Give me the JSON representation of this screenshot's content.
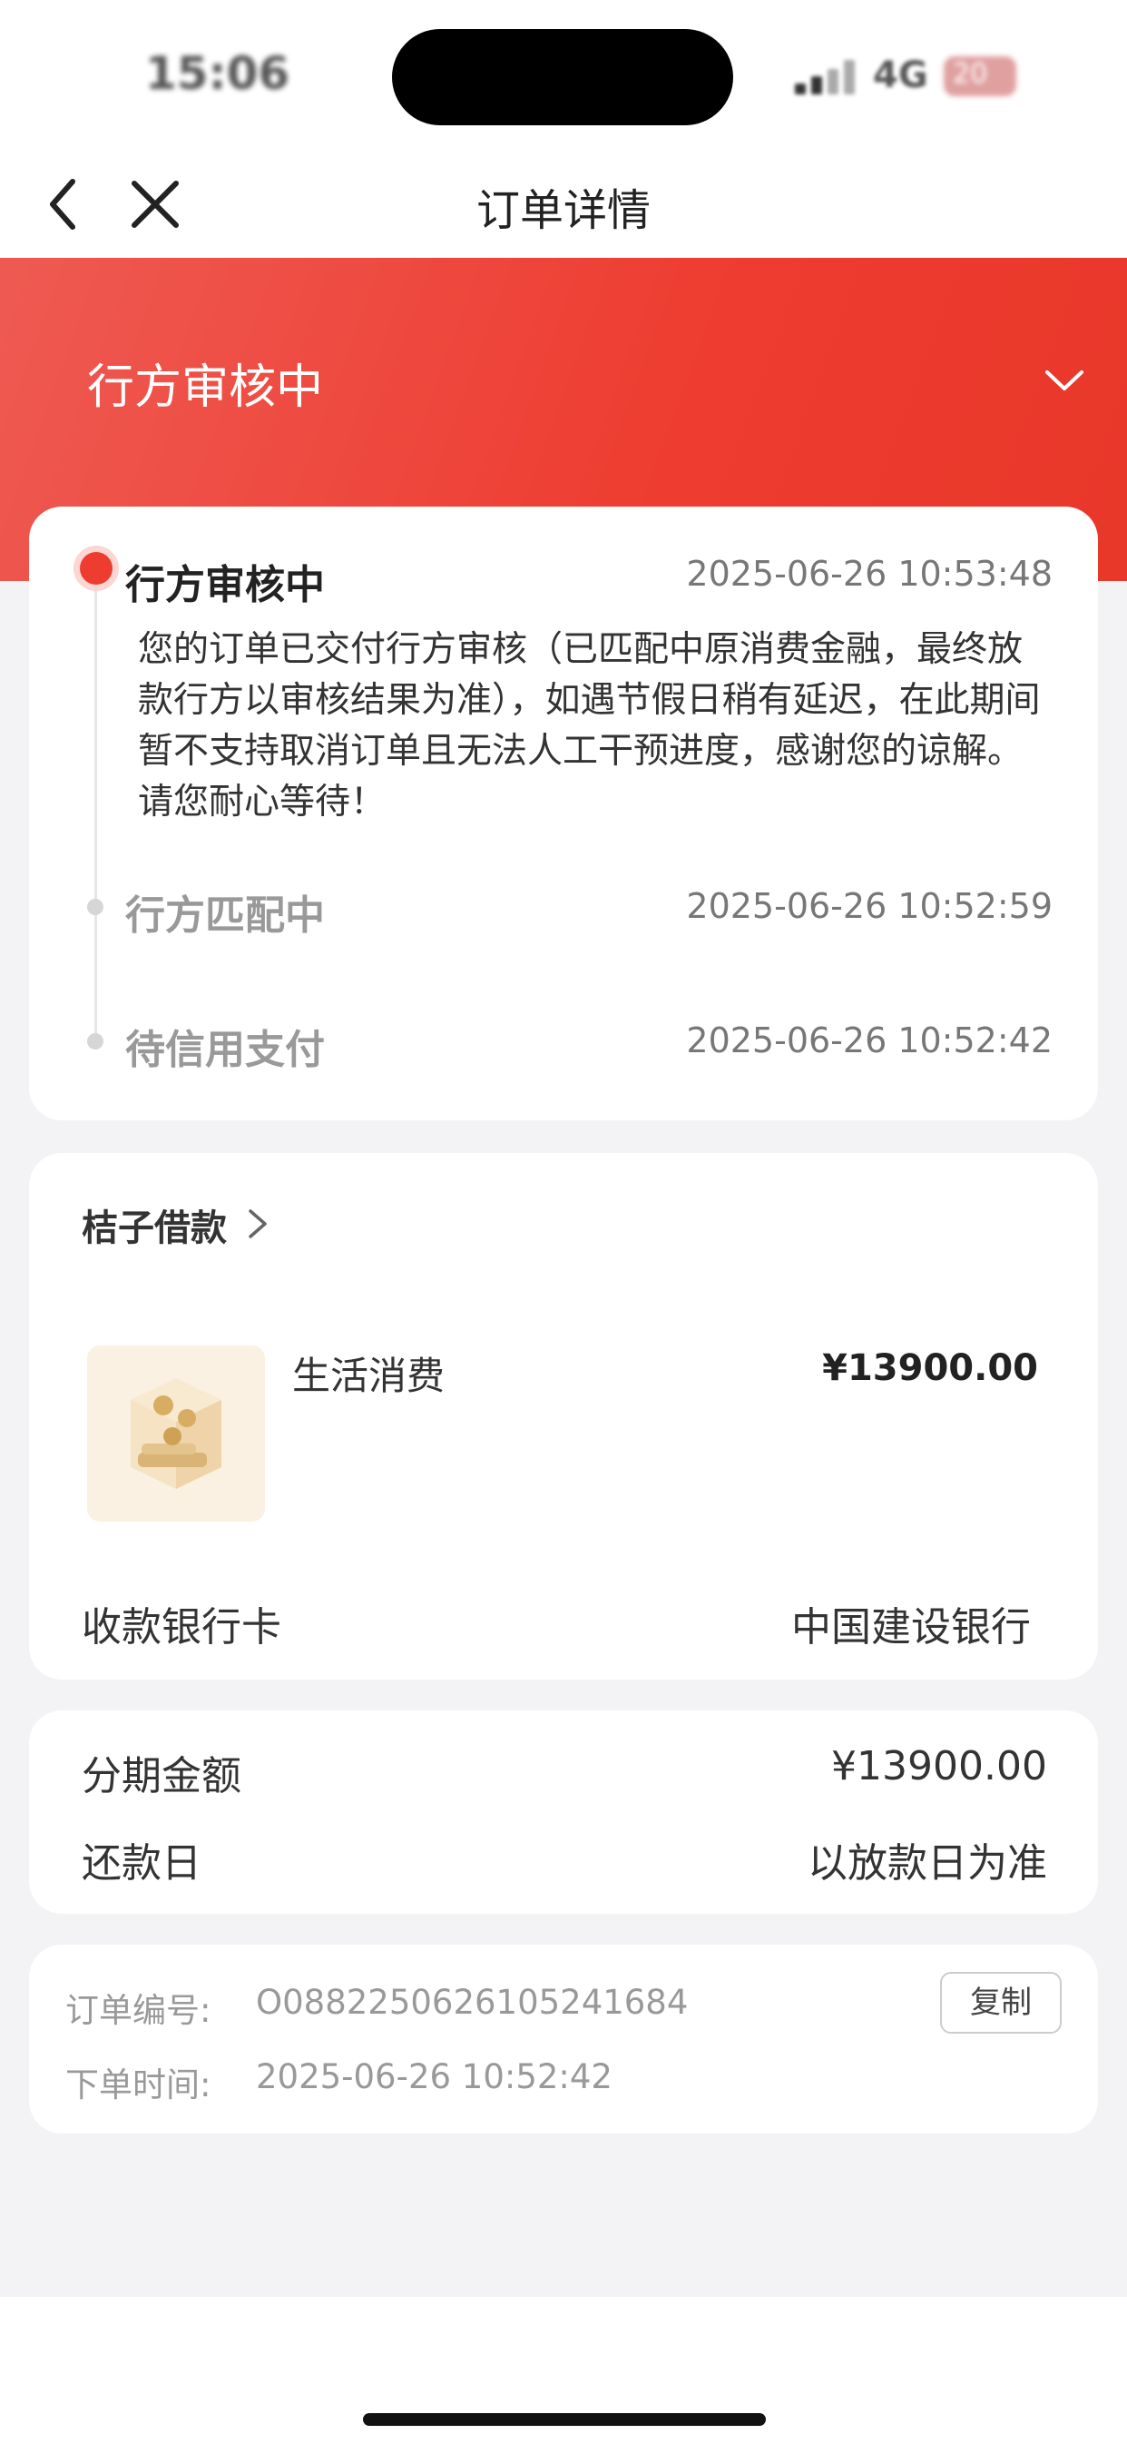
{
  "status_bar": {
    "time": "15:06",
    "network": "4G",
    "battery": "20"
  },
  "nav": {
    "title": "订单详情"
  },
  "hero": {
    "status_title": "行方审核中"
  },
  "timeline": {
    "steps": [
      {
        "label": "行方审核中",
        "time": "2025-06-26 10:53:48",
        "active": true,
        "description": "您的订单已交付行方审核（已匹配中原消费金融，最终放款行方以审核结果为准），如遇节假日稍有延迟，在此期间暂不支持取消订单且无法人工干预进度，感谢您的谅解。请您耐心等待！"
      },
      {
        "label": "行方匹配中",
        "time": "2025-06-26 10:52:59",
        "active": false
      },
      {
        "label": "待信用支付",
        "time": "2025-06-26 10:52:42",
        "active": false
      }
    ]
  },
  "loan": {
    "provider": "桔子借款",
    "product_name": "生活消费",
    "product_price": "¥13900.00",
    "bank_label": "收款银行卡",
    "bank_value": "中国建设银行"
  },
  "plan": {
    "amount_label": "分期金额",
    "amount_value": "¥13900.00",
    "repay_label": "还款日",
    "repay_value": "以放款日为准"
  },
  "order": {
    "number_label": "订单编号:",
    "number_value": "O0882250626105241684",
    "copy_label": "复制",
    "time_label": "下单时间:",
    "time_value": "2025-06-26 10:52:42"
  },
  "colors": {
    "accent": "#ee3c30",
    "background": "#f3f3f5"
  }
}
